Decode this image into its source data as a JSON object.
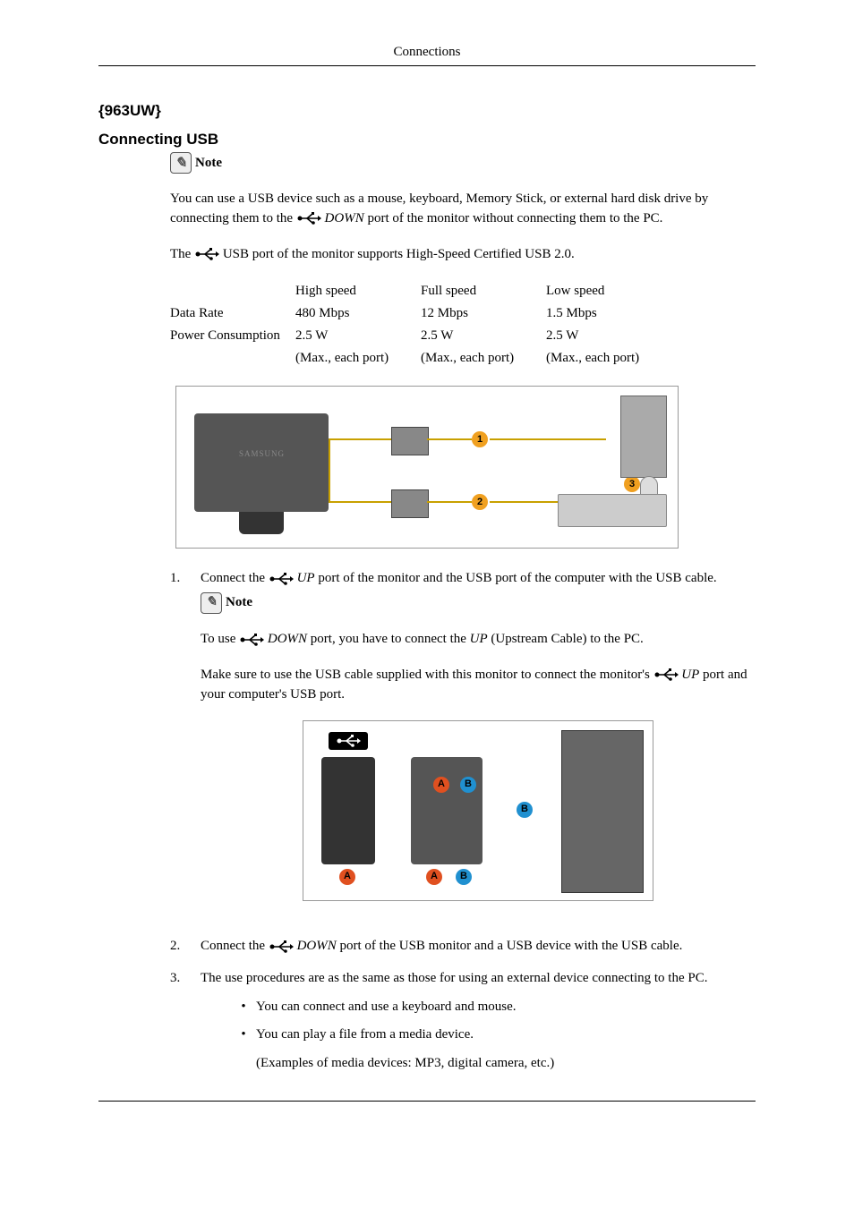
{
  "header": "Connections",
  "model_heading": "{963UW}",
  "section_title": "Connecting USB",
  "note_label": "Note",
  "intro": {
    "p1_a": "You can use a USB device such as a mouse, keyboard, Memory Stick, or external hard disk drive by connecting them to the ",
    "p1_down": "DOWN",
    "p1_b": " port of the monitor without connecting them to the PC.",
    "p2_a": "The ",
    "p2_b": " USB port of the monitor supports High-Speed Certified USB 2.0."
  },
  "chart_data": {
    "type": "table",
    "columns": [
      "",
      "High speed",
      "Full speed",
      "Low speed"
    ],
    "rows": [
      {
        "label": "Data Rate",
        "values": [
          "480 Mbps",
          "12 Mbps",
          "1.5 Mbps"
        ]
      },
      {
        "label": "Power Consumption",
        "values": [
          "2.5 W",
          "2.5 W",
          "2.5 W"
        ]
      }
    ],
    "footer_values": [
      "(Max., each port)",
      "(Max., each port)",
      "(Max., each port)"
    ]
  },
  "steps": {
    "s1": {
      "num": "1.",
      "a": "Connect the ",
      "up": "UP",
      "b": " port of the monitor and the USB port of the computer with the USB cable.",
      "note_a": "To use ",
      "note_down": "DOWN",
      "note_b": " port, you have to connect the ",
      "note_up": "UP",
      "note_c": "  (Upstream Cable) to the PC.",
      "p2_a": "Make sure to use the USB cable supplied with this monitor to connect the monitor's ",
      "p2_up": "UP",
      "p2_b": " port and your computer's USB port."
    },
    "s2": {
      "num": "2.",
      "a": "Connect the ",
      "down": "DOWN",
      "b": " port of the USB monitor and a USB device with the USB cable."
    },
    "s3": {
      "num": "3.",
      "text": "The use procedures are as the same as those for using an external device connecting to the PC.",
      "b1": "You can connect and use a keyboard and mouse.",
      "b2": "You can play a file from a media device.",
      "b2_sub": "(Examples of media devices: MP3, digital camera, etc.)"
    }
  },
  "badges": {
    "one": "1",
    "two": "2",
    "three": "3",
    "A": "A",
    "B": "B"
  }
}
